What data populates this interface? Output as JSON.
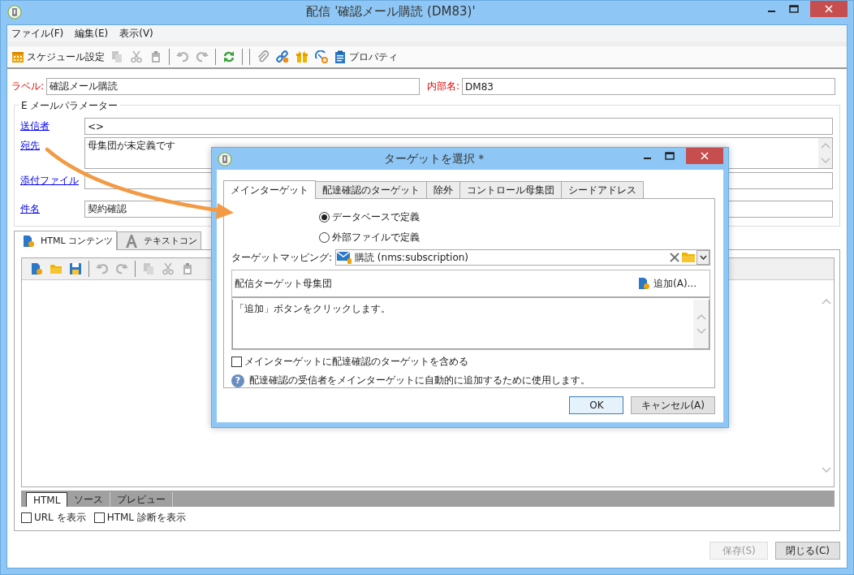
{
  "window": {
    "title": "配信 '確認メール購読 (DM83)'"
  },
  "menu": [
    "ファイル(F)",
    "編集(E)",
    "表示(V)"
  ],
  "toolbar": [
    {
      "kind": "calendar",
      "label": "スケジュール設定",
      "disabled": false
    },
    {
      "kind": "copy",
      "disabled": true
    },
    {
      "kind": "cut",
      "disabled": true
    },
    {
      "kind": "paste",
      "disabled": true
    },
    {
      "kind": "separator"
    },
    {
      "kind": "undo",
      "disabled": true
    },
    {
      "kind": "redo",
      "disabled": true
    },
    {
      "kind": "separator"
    },
    {
      "kind": "refresh",
      "disabled": false
    },
    {
      "kind": "separator"
    },
    {
      "kind": "separator"
    },
    {
      "kind": "attach",
      "disabled": false
    },
    {
      "kind": "link",
      "disabled": false
    },
    {
      "kind": "gift",
      "disabled": false
    },
    {
      "kind": "gauge",
      "disabled": false
    },
    {
      "kind": "clipboard",
      "label": "プロパティ",
      "disabled": false
    }
  ],
  "label_field": {
    "label": "ラベル:",
    "value": "確認メール購読"
  },
  "internal_name": {
    "label": "内部名:",
    "value": "DM83"
  },
  "email_params": {
    "title": "E メールパラメーター",
    "fields": [
      {
        "label": "送信者",
        "value": "<>",
        "kind": "single"
      },
      {
        "label": "宛先",
        "value": "母集団が未定義です",
        "kind": "multiline"
      },
      {
        "label": "添付ファイル",
        "kind": "single"
      },
      {
        "label": "件名",
        "value": "契約確認",
        "kind": "single"
      }
    ]
  },
  "content_tabs": [
    {
      "label": "HTML コンテンツ",
      "kind": "html",
      "selected": true
    },
    {
      "label": "テキストコン",
      "kind": "text",
      "selected": false
    }
  ],
  "editor_toolbar": [
    {
      "kind": "new",
      "disabled": false
    },
    {
      "kind": "open",
      "disabled": false
    },
    {
      "kind": "save",
      "disabled": false
    },
    {
      "kind": "separator"
    },
    {
      "kind": "undo",
      "disabled": true
    },
    {
      "kind": "redo",
      "disabled": true
    },
    {
      "kind": "separator"
    },
    {
      "kind": "copy",
      "disabled": true
    },
    {
      "kind": "cut",
      "disabled": true
    },
    {
      "kind": "paste",
      "disabled": true
    }
  ],
  "view_tabs": [
    {
      "label": "HTML",
      "selected": true
    },
    {
      "label": "ソース",
      "selected": false
    },
    {
      "label": "プレビュー",
      "selected": false
    }
  ],
  "options": [
    {
      "label": "URL を表示",
      "checked": false
    },
    {
      "label": "HTML 診断を表示",
      "checked": false
    }
  ],
  "buttons": [
    {
      "label": "保存(S)",
      "disabled": true
    },
    {
      "label": "閉じる(C)",
      "disabled": false
    }
  ],
  "dialog": {
    "title": "ターゲットを選択 *",
    "tabs": [
      {
        "label": "メインターゲット",
        "selected": true
      },
      {
        "label": "配達確認のターゲット",
        "selected": false
      },
      {
        "label": "除外",
        "selected": false
      },
      {
        "label": "コントロール母集団",
        "selected": false
      },
      {
        "label": "シードアドレス",
        "selected": false
      }
    ],
    "source_options": [
      {
        "label": "データベースで定義",
        "selected": true
      },
      {
        "label": "外部ファイルで定義",
        "selected": false
      }
    ],
    "mapping": {
      "label": "ターゲットマッピング:",
      "value": "購読 (nms:subscription)"
    },
    "population": {
      "title": "配信ターゲット母集団",
      "add_button": "追加(A)...",
      "hint": "「追加」ボタンをクリックします。"
    },
    "include_proof": {
      "label": "メインターゲットに配達確認のターゲットを含める",
      "checked": false
    },
    "help": {
      "icon": "?",
      "text": "配達確認の受信者をメインターゲットに自動的に追加するために使用します。"
    },
    "buttons": [
      {
        "label": "OK",
        "kind": "default"
      },
      {
        "label": "キャンセル(A)",
        "kind": "normal"
      }
    ]
  }
}
